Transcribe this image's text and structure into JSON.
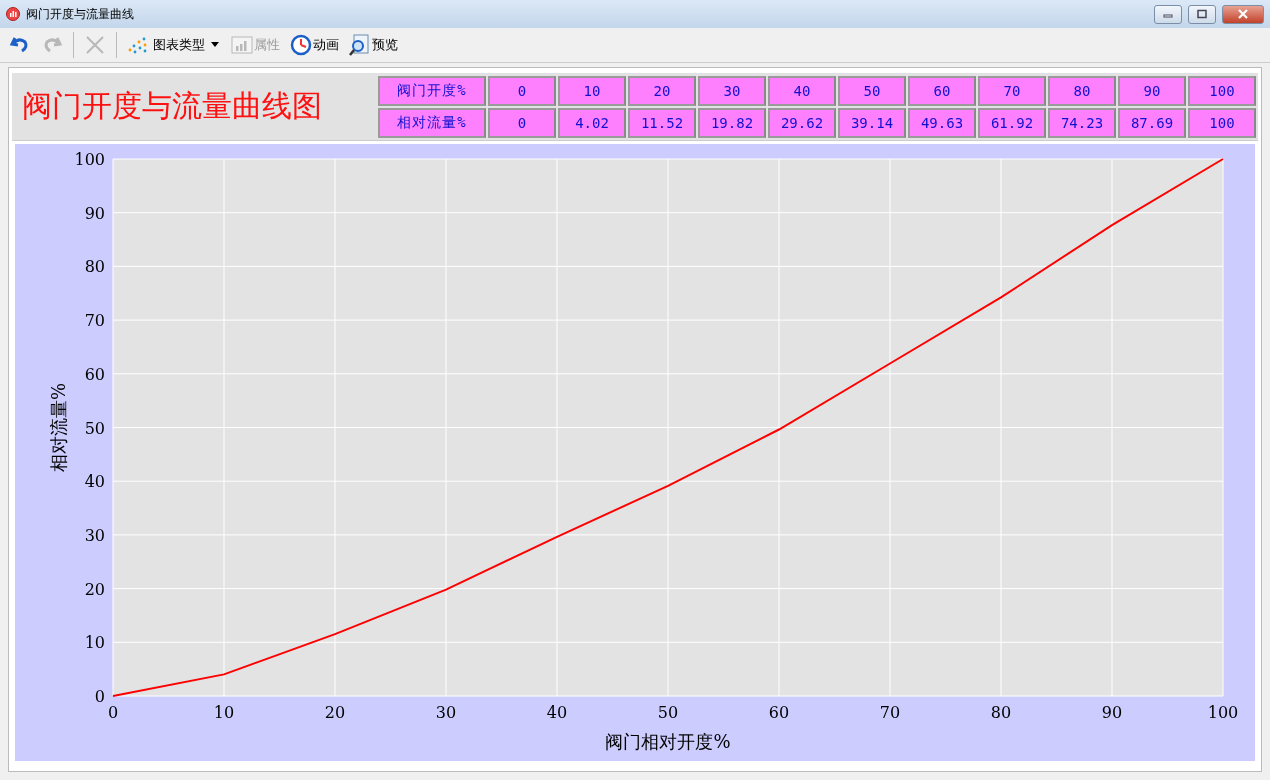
{
  "window": {
    "title": "阀门开度与流量曲线"
  },
  "toolbar": [
    {
      "kind": "undo",
      "disabled": false
    },
    {
      "kind": "redo",
      "disabled": true
    },
    {
      "kind": "delete",
      "disabled": true
    },
    {
      "kind": "chart-type",
      "label": "图表类型",
      "disabled": false
    },
    {
      "kind": "properties",
      "label": "属性",
      "disabled": true
    },
    {
      "kind": "animation",
      "label": "动画",
      "disabled": false
    },
    {
      "kind": "preview",
      "label": "预览",
      "disabled": false
    }
  ],
  "report": {
    "title": "阀门开度与流量曲线图",
    "table": {
      "rows": [
        {
          "header": "阀门开度%",
          "cells": [
            "0",
            "10",
            "20",
            "30",
            "40",
            "50",
            "60",
            "70",
            "80",
            "90",
            "100"
          ]
        },
        {
          "header": "相对流量%",
          "cells": [
            "0",
            "4.02",
            "11.52",
            "19.82",
            "29.62",
            "39.14",
            "49.63",
            "61.92",
            "74.23",
            "87.69",
            "100"
          ]
        }
      ]
    },
    "chart_data": {
      "type": "line",
      "xlabel": "阀门相对开度%",
      "ylabel": "相对流量%",
      "x": [
        0,
        10,
        20,
        30,
        40,
        50,
        60,
        70,
        80,
        90,
        100
      ],
      "grid": true,
      "series": [
        {
          "color": "#ff0000",
          "values": [
            0,
            4.02,
            11.52,
            19.82,
            29.62,
            39.14,
            49.63,
            61.92,
            74.23,
            87.69,
            100
          ]
        }
      ],
      "xlim": [
        0,
        100
      ],
      "ylim": [
        0,
        100
      ],
      "xticks": [
        0,
        10,
        20,
        30,
        40,
        50,
        60,
        70,
        80,
        90,
        100
      ],
      "yticks": [
        0,
        10,
        20,
        30,
        40,
        50,
        60,
        70,
        80,
        90,
        100
      ]
    }
  }
}
